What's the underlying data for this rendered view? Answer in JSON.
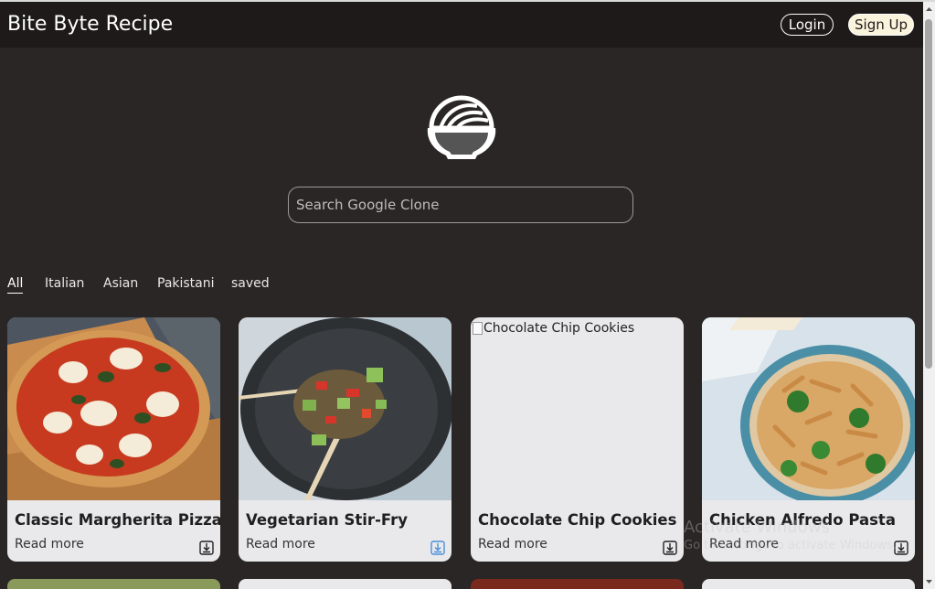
{
  "navbar": {
    "brand": "Bite Byte Recipe",
    "login_label": "Login",
    "signup_label": "Sign Up"
  },
  "search": {
    "placeholder": "Search Google Clone"
  },
  "tabs": [
    {
      "label": "All",
      "active": true
    },
    {
      "label": "Italian"
    },
    {
      "label": "Asian"
    },
    {
      "label": "Pakistani"
    },
    {
      "label": "saved"
    }
  ],
  "cards": [
    {
      "title": "Classic Margherita Pizza",
      "read_more": "Read more",
      "image_alt": ""
    },
    {
      "title": "Vegetarian Stir-Fry",
      "read_more": "Read more",
      "image_alt": "",
      "saved": true
    },
    {
      "title": "Chocolate Chip Cookies",
      "read_more": "Read more",
      "image_alt": "Chocolate Chip Cookies"
    },
    {
      "title": "Chicken Alfredo Pasta",
      "read_more": "Read more",
      "image_alt": ""
    }
  ],
  "watermark": {
    "title": "Activate Windows",
    "subtitle": "Go to Settings to activate Windows."
  },
  "colors": {
    "background": "#2a2625",
    "navbar": "#1d1a19",
    "card": "#e9e9ec",
    "saved_icon": "#4a90d9"
  }
}
